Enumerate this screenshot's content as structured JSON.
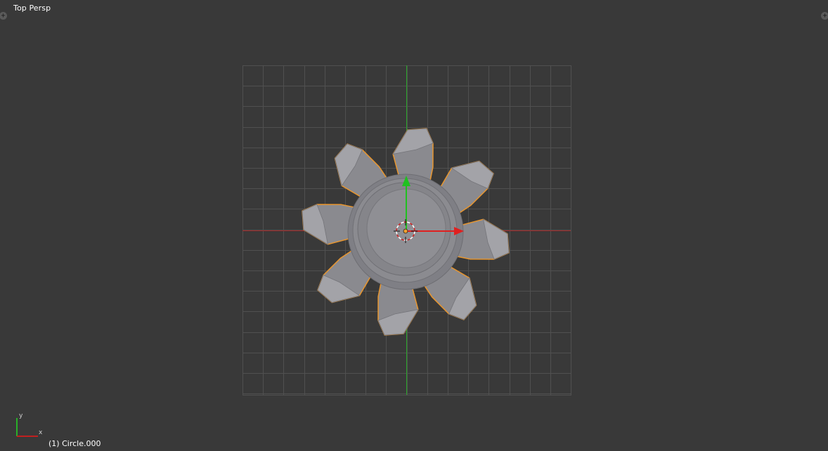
{
  "viewport": {
    "view_label": "Top Persp",
    "object_label": "(1) Circle.000",
    "corner_widget_symbol": "+",
    "mini_axes": {
      "y_label": "y",
      "x_label": "x"
    }
  },
  "colors": {
    "background": "#393939",
    "grid": "#505050",
    "x_axis": "#a62626",
    "y_axis": "#29a329",
    "mesh_fill": "#8a8a8f",
    "selection_outline": "#e8962f",
    "gizmo_x": "#e02020",
    "gizmo_y": "#20c020"
  },
  "icons": {
    "corner_widget": "plus-icon",
    "origin": "object-origin-icon",
    "cursor": "3d-cursor-icon",
    "gizmo": "transform-manipulator-icon"
  }
}
